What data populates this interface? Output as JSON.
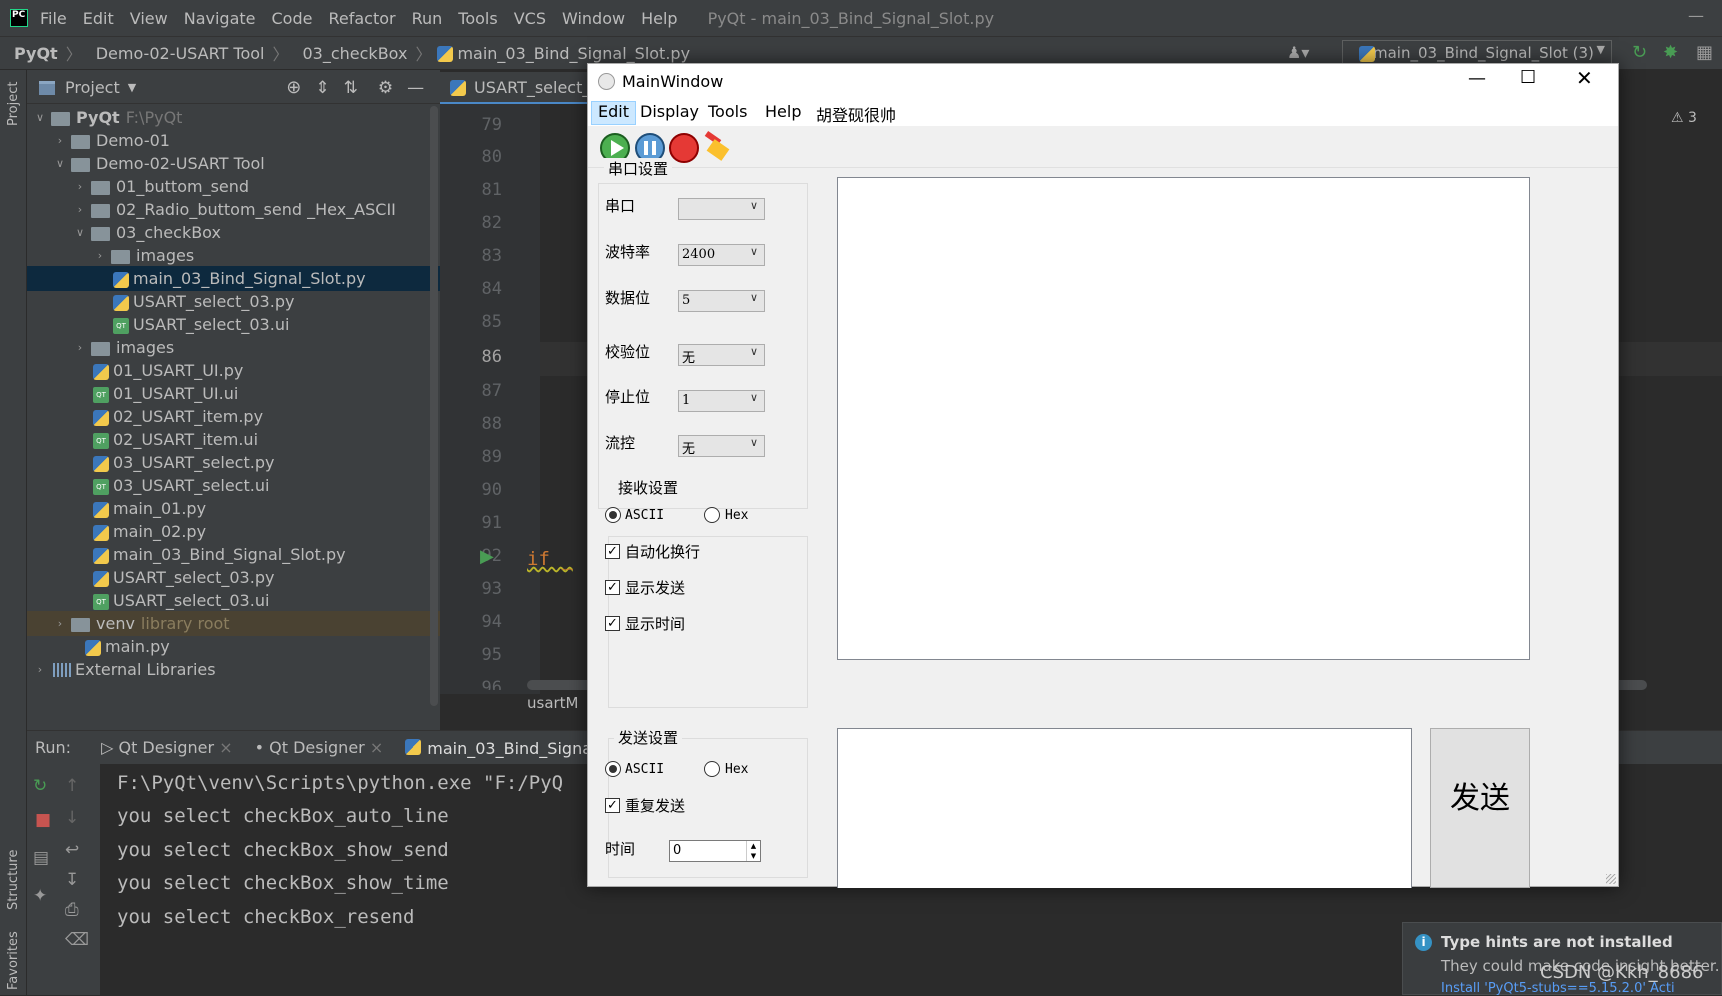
{
  "ide": {
    "menu": [
      "File",
      "Edit",
      "View",
      "Navigate",
      "Code",
      "Refactor",
      "Run",
      "Tools",
      "VCS",
      "Window",
      "Help"
    ],
    "window_title": "PyQt - main_03_Bind_Signal_Slot.py",
    "breadcrumb": [
      "PyQt",
      "Demo-02-USART Tool",
      "03_checkBox",
      "main_03_Bind_Signal_Slot.py"
    ],
    "run_config": "main_03_Bind_Signal_Slot (3)",
    "project_label": "Project",
    "stripe": {
      "project": "Project",
      "structure": "Structure",
      "favorites": "Favorites"
    },
    "tree": [
      {
        "name": "PyQt",
        "extra": "F:\\PyQt"
      },
      {
        "name": "Demo-01"
      },
      {
        "name": "Demo-02-USART Tool"
      },
      {
        "name": "01_buttom_send"
      },
      {
        "name": "02_Radio_buttom_send _Hex_ASCII"
      },
      {
        "name": "03_checkBox"
      },
      {
        "name": "images"
      },
      {
        "name": "main_03_Bind_Signal_Slot.py"
      },
      {
        "name": "USART_select_03.py"
      },
      {
        "name": "USART_select_03.ui"
      },
      {
        "name": "images"
      },
      {
        "name": "01_USART_UI.py"
      },
      {
        "name": "01_USART_UI.ui"
      },
      {
        "name": "02_USART_item.py"
      },
      {
        "name": "02_USART_item.ui"
      },
      {
        "name": "03_USART_select.py"
      },
      {
        "name": "03_USART_select.ui"
      },
      {
        "name": "main_01.py"
      },
      {
        "name": "main_02.py"
      },
      {
        "name": "main_03_Bind_Signal_Slot.py"
      },
      {
        "name": "USART_select_03.py"
      },
      {
        "name": "USART_select_03.ui"
      },
      {
        "name": "venv",
        "extra": "library root"
      },
      {
        "name": "main.py"
      },
      {
        "name": "External Libraries"
      }
    ],
    "editor_tab": "USART_select_",
    "line_numbers": [
      "79",
      "80",
      "81",
      "82",
      "83",
      "84",
      "85",
      "86",
      "87",
      "88",
      "89",
      "90",
      "91",
      "92",
      "93",
      "94",
      "95",
      "96"
    ],
    "if_keyword": "if _",
    "editor_footer": "usartM",
    "warning": "⚠ 3",
    "run": {
      "label": "Run:",
      "tabs": [
        "Qt Designer",
        "Qt Designer",
        "main_03_Bind_Signal"
      ],
      "console": [
        "F:\\PyQt\\venv\\Scripts\\python.exe \"F:/PyQ",
        "you select checkBox_auto_line",
        "you select checkBox_show_send",
        "you select checkBox_show_time",
        "you select checkBox_resend"
      ]
    },
    "notification": {
      "title": "Type hints are not installed",
      "body": "They could make code insight better.",
      "link": "Install 'PyQt5-stubs==5.15.2.0'   Acti"
    },
    "watermark": "CSDN @Kkh_8686"
  },
  "mainwindow": {
    "title": "MainWindow",
    "menu": [
      "Edit",
      "Display",
      "Tools",
      "Help",
      "胡登砚很帅"
    ],
    "toolbar_icons": [
      "play-icon",
      "pause-icon",
      "record-icon",
      "clear-broom-icon"
    ],
    "serial_group": {
      "title": "串口设置",
      "fields": [
        {
          "label": "串口",
          "value": ""
        },
        {
          "label": "波特率",
          "value": "2400"
        },
        {
          "label": "数据位",
          "value": "5"
        },
        {
          "label": "校验位",
          "value": "无"
        },
        {
          "label": "停止位",
          "value": "1"
        },
        {
          "label": "流控",
          "value": "无"
        }
      ]
    },
    "recv_group": {
      "title": "接收设置",
      "ascii": "ASCII",
      "hex": "Hex",
      "checks": [
        "自动化换行",
        "显示发送",
        "显示时间"
      ]
    },
    "send_group": {
      "title": "发送设置",
      "ascii": "ASCII",
      "hex": "Hex",
      "repeat": "重复发送",
      "time_label": "时间",
      "time_value": "0"
    },
    "send_button": "发送"
  }
}
